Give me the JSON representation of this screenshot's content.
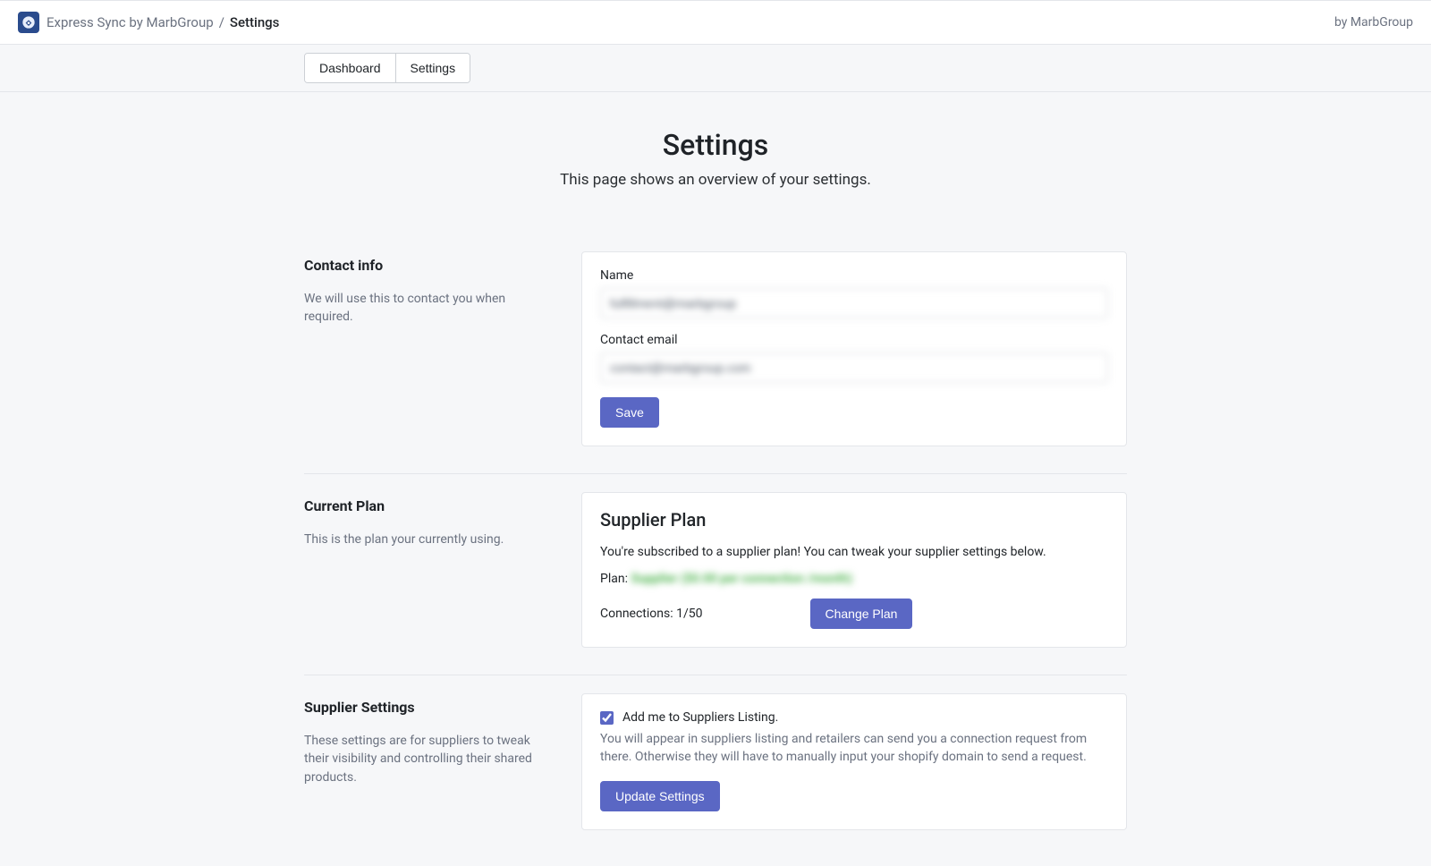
{
  "header": {
    "app_name": "Express Sync by MarbGroup",
    "separator": "/",
    "current_page": "Settings",
    "vendor": "by MarbGroup"
  },
  "nav": {
    "dashboard": "Dashboard",
    "settings": "Settings"
  },
  "page": {
    "title": "Settings",
    "subtitle": "This page shows an overview of your settings."
  },
  "contact": {
    "heading": "Contact info",
    "desc": "We will use this to contact you when required.",
    "name_label": "Name",
    "name_value": "fulfillment@marbgroup",
    "email_label": "Contact email",
    "email_value": "contact@marbgroup.com",
    "save": "Save"
  },
  "plan": {
    "side_heading": "Current Plan",
    "side_desc": "This is the plan your currently using.",
    "title": "Supplier Plan",
    "desc": "You're subscribed to a supplier plan! You can tweak your supplier settings below.",
    "plan_prefix": "Plan: ",
    "plan_value": "Supplier ($0.00 per connection /month)",
    "connections_prefix": "Connections: ",
    "connections_value": "1/50",
    "change_plan": "Change Plan"
  },
  "supplier": {
    "heading": "Supplier Settings",
    "desc": "These settings are for suppliers to tweak their visibility and controlling their shared products.",
    "checkbox_label": "Add me to Suppliers Listing.",
    "help": "You will appear in suppliers listing and retailers can send you a connection request from there. Otherwise they will have to manually input your shopify domain to send a request.",
    "update": "Update Settings"
  }
}
